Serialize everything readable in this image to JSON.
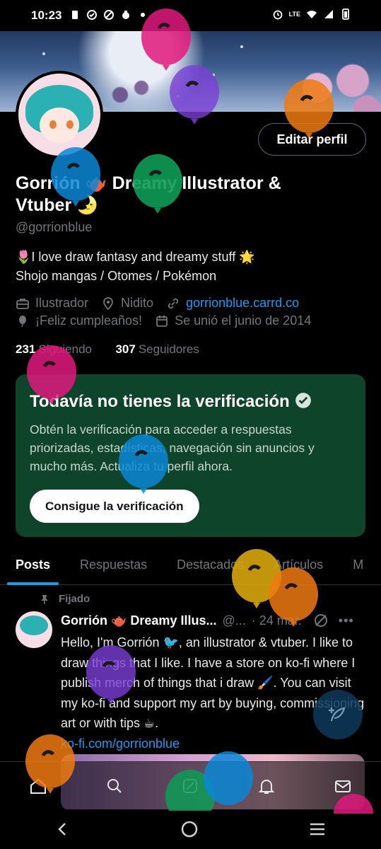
{
  "status_bar": {
    "time": "10:23",
    "network_label": "LTE"
  },
  "profile": {
    "edit_button": "Editar perfil",
    "name_line": "Gorrión 🫖 Dreamy Illustrator & Vtuber 🌛",
    "handle": "@gorrionblue",
    "bio_line1": "🌷I love draw fantasy and dreamy stuff 🌟",
    "bio_line2": "Shojo mangas / Otomes / Pokémon",
    "occupation": "Ilustrador",
    "location": "Nidito",
    "website": "gorrionblue.carrd.co",
    "birthday": "¡Feliz cumpleaños!",
    "joined": "Se unió el junio de 2014",
    "following_count": "231",
    "following_label": "Siguiendo",
    "followers_count": "307",
    "followers_label": "Seguidores"
  },
  "verification": {
    "title": "Todavía no tienes la verificación",
    "body": "Obtén la verificación para acceder a respuestas priorizadas, estadísticas, navegación sin anuncios y mucho más. Actualiza tu perfil ahora.",
    "button": "Consigue la verificación"
  },
  "tabs": [
    "Posts",
    "Respuestas",
    "Destacados",
    "Artículos",
    "M"
  ],
  "post": {
    "pinned_label": "Fijado",
    "author": "Gorrión 🫖 Dreamy Illus...",
    "handle_short": "@...",
    "date": "· 24 mar.",
    "text": "Hello, I'm Gorrión 🐦, an illustrator & vtuber. I like to draw things that I like. I have a store on ko-fi where I publish merch of things that i draw 🖌️. You can visit my ko-fi and support my art by buying, commissioning art or with tips ☕.",
    "link": "ko-fi.com/gorrionblue"
  },
  "colors": {
    "background": "#000000",
    "accent": "#1d9bf0",
    "verify_card": "#0e4429",
    "muted_text": "#71767b"
  },
  "icons": [
    "briefcase-icon",
    "location-pin-icon",
    "link-icon",
    "balloon-icon",
    "calendar-icon",
    "pin-icon",
    "grok-icon",
    "more-icon",
    "compose-icon",
    "home-icon",
    "search-icon",
    "grok-nav-icon",
    "notifications-icon",
    "messages-icon",
    "back-icon",
    "home-circle-icon",
    "recents-icon"
  ]
}
